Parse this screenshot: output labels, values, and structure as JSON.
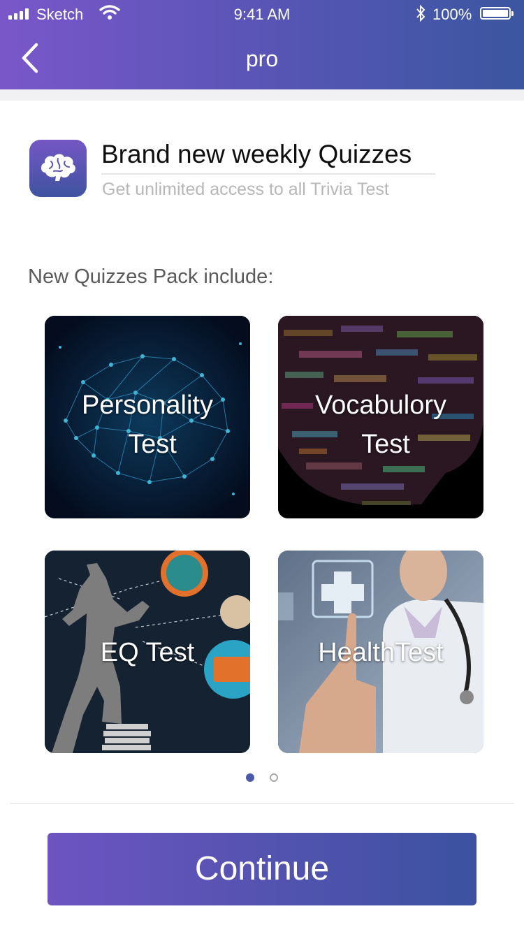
{
  "status_bar": {
    "carrier": "Sketch",
    "time": "9:41 AM",
    "battery": "100%"
  },
  "nav": {
    "title": "pro"
  },
  "promo": {
    "headline": "Brand new weekly Quizzes",
    "subheadline": "Get unlimited access to all Trivia Test",
    "icon": "brain-icon"
  },
  "pack": {
    "title": "New Quizzes Pack include:",
    "cards": [
      {
        "line1": "Personality",
        "line2": "Test"
      },
      {
        "line1": "Vocabulory",
        "line2": "Test"
      },
      {
        "label": "EQ Test"
      },
      {
        "label": "HealthTest"
      }
    ]
  },
  "pager": {
    "total": 2,
    "current": 1
  },
  "continue_label": "Continue",
  "colors": {
    "accent_start": "#7a57c9",
    "accent_end": "#3b56a0"
  }
}
